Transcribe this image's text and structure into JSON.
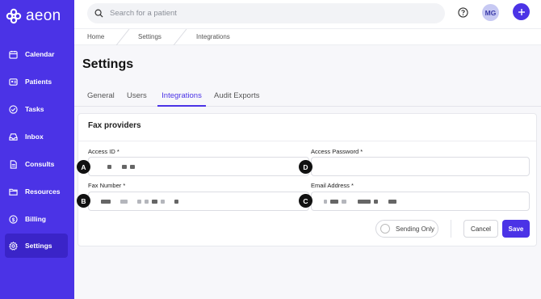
{
  "app": {
    "brand": "aeon"
  },
  "sidebar": {
    "items": [
      {
        "label": "Calendar",
        "icon": "calendar-icon"
      },
      {
        "label": "Patients",
        "icon": "patients-icon"
      },
      {
        "label": "Tasks",
        "icon": "tasks-icon"
      },
      {
        "label": "Inbox",
        "icon": "inbox-icon"
      },
      {
        "label": "Consults",
        "icon": "consults-icon"
      },
      {
        "label": "Resources",
        "icon": "folder-icon"
      },
      {
        "label": "Billing",
        "icon": "billing-icon"
      },
      {
        "label": "Settings",
        "icon": "gear-icon",
        "active": true
      }
    ]
  },
  "topbar": {
    "search_placeholder": "Search for a patient",
    "avatar_initials": "MG"
  },
  "breadcrumb": [
    "Home",
    "Settings",
    "Integrations"
  ],
  "page": {
    "title": "Settings"
  },
  "tabs": [
    {
      "label": "General"
    },
    {
      "label": "Users"
    },
    {
      "label": "Integrations",
      "active": true
    },
    {
      "label": "Audit Exports"
    }
  ],
  "fax": {
    "title": "Fax providers",
    "fields": {
      "access_id": {
        "label": "Access ID *",
        "marker": "A"
      },
      "access_password": {
        "label": "Access Password *",
        "marker": "D"
      },
      "fax_number": {
        "label": "Fax Number *",
        "marker": "B"
      },
      "email_address": {
        "label": "Email Address *",
        "marker": "C"
      }
    },
    "toggle_label": "Sending Only",
    "cancel_label": "Cancel",
    "save_label": "Save"
  },
  "colors": {
    "brand": "#4b33e6",
    "sidebar_active": "#3a24c8"
  }
}
